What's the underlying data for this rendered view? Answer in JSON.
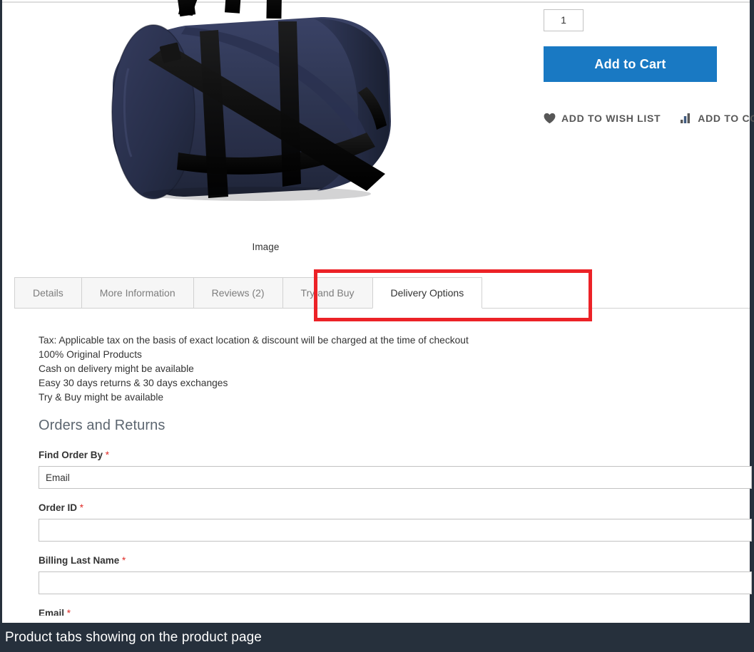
{
  "product": {
    "image_alt": "navy-duffel-bag",
    "image_caption": "Image",
    "qty_value": "1",
    "add_to_cart_label": "Add to Cart",
    "links": [
      {
        "label": "ADD TO WISH LIST",
        "icon": "heart-icon"
      },
      {
        "label": "ADD TO COMPARE",
        "icon": "compare-bars-icon"
      }
    ]
  },
  "tabs": {
    "items": [
      {
        "label": "Details",
        "active": false
      },
      {
        "label": "More Information",
        "active": false
      },
      {
        "label": "Reviews (2)",
        "active": false
      },
      {
        "label": "Try and Buy",
        "active": false
      },
      {
        "label": "Delivery Options",
        "active": true
      }
    ]
  },
  "tab_content": {
    "info_lines": [
      "Tax: Applicable tax on the basis of exact location & discount will be charged at the time of checkout",
      "100% Original Products",
      "Cash on delivery might be available",
      "Easy 30 days returns & 30 days exchanges",
      "Try & Buy might be available"
    ],
    "section_title": "Orders and Returns",
    "form": {
      "fields": [
        {
          "label": "Find Order By",
          "required": true,
          "value": "Email",
          "control": "select"
        },
        {
          "label": "Order ID",
          "required": true,
          "value": "",
          "control": "text"
        },
        {
          "label": "Billing Last Name",
          "required": true,
          "value": "",
          "control": "text"
        },
        {
          "label": "Email",
          "required": true,
          "value": "",
          "control": "text"
        }
      ],
      "required_marker": "*"
    }
  },
  "caption": {
    "text": "Product tabs showing on the product page"
  },
  "colors": {
    "accent_button": "#1979c3",
    "annotation": "#ec2227",
    "caption_bar": "#26303c",
    "required_star": "#e02b27",
    "bag_body": "#2e3550",
    "bag_strap": "#101010"
  }
}
